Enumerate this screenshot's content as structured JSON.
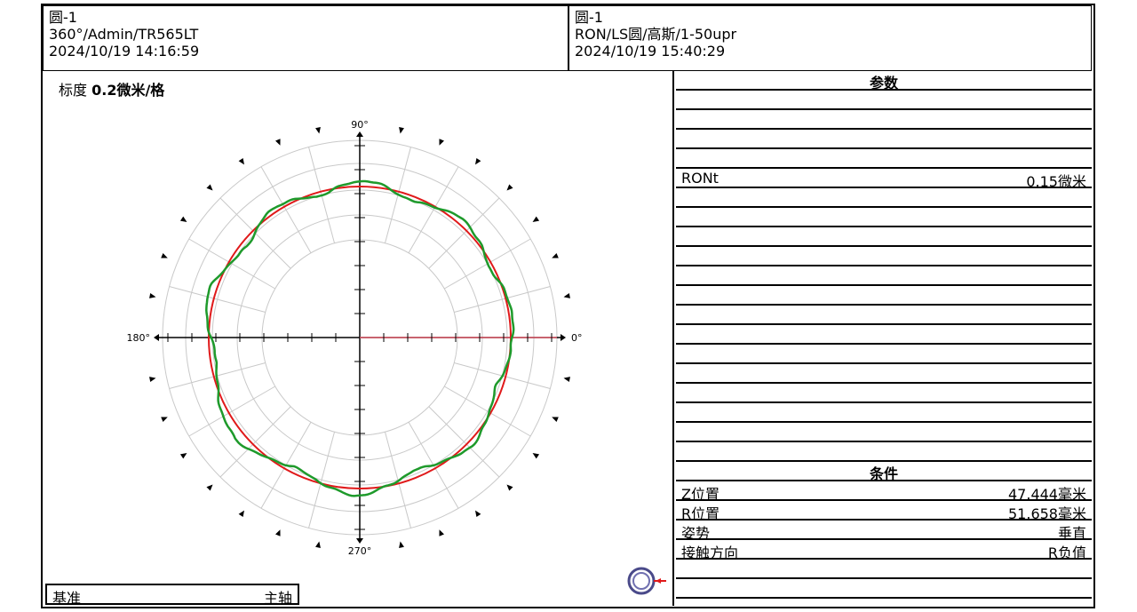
{
  "header_left": {
    "name": "圆-1",
    "mode": "360°/Admin/TR565LT",
    "datetime": "2024/10/19 14:16:59"
  },
  "header_right": {
    "name": "圆-1",
    "mode": "RON/LS圆/高斯/1-50upr",
    "datetime": "2024/10/19 15:40:29"
  },
  "scale": {
    "prefix": "标度",
    "value": "0.2微米/格"
  },
  "parameters": {
    "title": "参数",
    "items": [
      {
        "label": "RONt",
        "value": "0.15微米"
      }
    ]
  },
  "conditions": {
    "title": "条件",
    "items": [
      {
        "label": "Z位置",
        "value": "47.444毫米"
      },
      {
        "label": "R位置",
        "value": "51.658毫米"
      },
      {
        "label": "姿势",
        "value": "垂直"
      },
      {
        "label": "接触方向",
        "value": "R负值"
      }
    ]
  },
  "reference": {
    "label": "基准",
    "value": "主轴"
  },
  "chart_data": {
    "type": "polar",
    "angle_labels": {
      "deg_0": "0°",
      "deg_90": "90°",
      "deg_180": "180°",
      "deg_270": "270°"
    },
    "scale_per_division_um": 0.2,
    "reference_circle_color": "#e0191a",
    "profile_color": "#1e9a2b",
    "RONt_um": 0.15,
    "profile_deviation_um": [
      0.01,
      0.02,
      0.03,
      0.02,
      0.0,
      -0.02,
      -0.03,
      -0.01,
      0.02,
      0.04,
      0.05,
      0.03,
      0.01,
      -0.02,
      -0.04,
      -0.03,
      0.0,
      0.03,
      0.05,
      0.04,
      0.01,
      -0.02,
      -0.03,
      -0.01,
      0.02,
      0.04,
      0.03,
      0.0,
      -0.03,
      -0.05,
      -0.04,
      -0.01,
      0.02,
      0.05,
      0.06,
      0.04,
      0.01,
      -0.02,
      -0.04,
      -0.05,
      -0.03,
      0.0,
      0.03,
      0.05,
      0.07,
      0.08,
      0.06,
      0.03,
      0.0,
      -0.03,
      -0.05,
      -0.04,
      -0.02,
      0.01,
      0.04,
      0.06,
      0.05,
      0.02,
      -0.01,
      -0.04,
      -0.06,
      -0.05,
      -0.03,
      0.0,
      0.03,
      0.04,
      0.03,
      0.01,
      -0.02,
      -0.04,
      -0.05,
      -0.03,
      -0.01,
      0.01
    ]
  }
}
